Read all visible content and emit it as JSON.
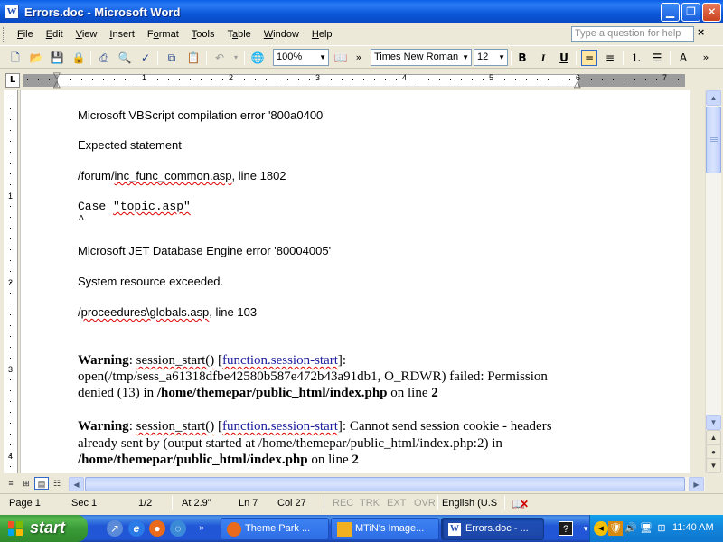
{
  "window": {
    "title": "Errors.doc - Microsoft Word",
    "app_icon": "W"
  },
  "menu": {
    "items": [
      {
        "key": "F",
        "rest": "ile"
      },
      {
        "key": "E",
        "rest": "dit"
      },
      {
        "key": "V",
        "rest": "iew"
      },
      {
        "key": "I",
        "rest": "nsert"
      },
      {
        "key": "",
        "rest": "Format",
        "key2": "o"
      },
      {
        "key": "T",
        "rest": "ools"
      },
      {
        "key": "",
        "rest": "Table",
        "key2": "a"
      },
      {
        "key": "W",
        "rest": "indow"
      },
      {
        "key": "H",
        "rest": "elp"
      }
    ],
    "labels": [
      "File",
      "Edit",
      "View",
      "Insert",
      "Format",
      "Tools",
      "Table",
      "Window",
      "Help"
    ],
    "ask_placeholder": "Type a question for help",
    "close_doc": "×"
  },
  "toolbar": {
    "zoom": "100%",
    "font": "Times New Roman",
    "size": "12",
    "bold": "B",
    "italic": "I",
    "underline": "U",
    "overflow": "»"
  },
  "ruler": {
    "corner": "L",
    "h_numbers": [
      "1",
      "2",
      "3",
      "4",
      "5",
      "6",
      "7"
    ],
    "v_numbers": [
      "1",
      "2",
      "3",
      "4"
    ]
  },
  "document": {
    "lines": [
      {
        "text": "Microsoft VBScript compilation error '800a0400'"
      },
      {
        "text": "Expected statement"
      },
      {
        "pre": "/forum/",
        "squig": "inc_func_common.asp",
        "post": ", line 1802"
      },
      {
        "code_kw": "Case ",
        "code_str": "\"topic.asp\""
      },
      {
        "caret": "^"
      },
      {
        "text": "Microsoft JET Database Engine error '80004005'"
      },
      {
        "text": "System resource exceeded."
      },
      {
        "pre": "/",
        "squig": "proceedures\\globals.asp",
        "post": ", line 103"
      }
    ],
    "warning1": {
      "label": "Warning",
      "fn": "session_start()",
      "link": "function.session-start",
      "line2": "open(/tmp/sess_a61318dfbe42580b587e472b43a91db1, O_RDWR) failed: Permission",
      "line3_pre": "denied (13) in ",
      "path": "/home/themepar/public_html/index.php",
      "line3_mid": " on line ",
      "lineno": "2"
    },
    "warning2": {
      "label": "Warning",
      "fn": "session_start()",
      "link": "function.session-start",
      "tail": ": Cannot send session cookie - headers",
      "line2": "already sent by (output started at /home/themepar/public_html/index.php:2) in",
      "path": "/home/themepar/public_html/index.php",
      "line3_mid": " on line ",
      "lineno": "2"
    }
  },
  "status": {
    "page": "Page 1",
    "sec": "Sec 1",
    "pages": "1/2",
    "at": "At 2.9\"",
    "ln": "Ln 7",
    "col": "Col 27",
    "rec": "REC",
    "trk": "TRK",
    "ext": "EXT",
    "ovr": "OVR",
    "lang": "English (U.S"
  },
  "taskbar": {
    "start": "start",
    "tasks": [
      {
        "label": "Theme Park ..."
      },
      {
        "label": "MTiN's Image..."
      },
      {
        "label": "Errors.doc - ..."
      }
    ],
    "clock": "11:40 AM"
  },
  "colors": {
    "titlebar": "#0A5FE6",
    "taskbar": "#2157D7",
    "start": "#3A9B37",
    "spell_error": "#E00000",
    "link": "#1C1C9C"
  }
}
